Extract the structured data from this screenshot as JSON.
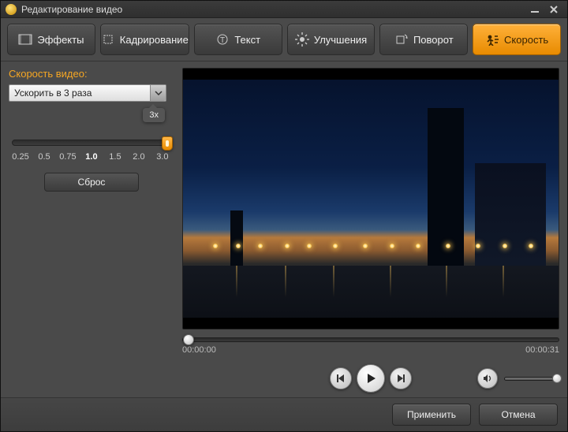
{
  "titlebar": {
    "title": "Редактирование видео"
  },
  "tabs": {
    "effects": "Эффекты",
    "crop": "Кадрирование",
    "text": "Текст",
    "enhance": "Улучшения",
    "rotate": "Поворот",
    "speed": "Скорость"
  },
  "speed": {
    "label": "Скорость видео:",
    "select_value": "Ускорить в 3 раза",
    "tooltip": "3x",
    "reset": "Сброс",
    "ticks": [
      "0.25",
      "0.5",
      "0.75",
      "1.0",
      "1.5",
      "2.0",
      "3.0"
    ]
  },
  "player": {
    "cur_time": "00:00:00",
    "total_time": "00:00:31"
  },
  "footer": {
    "apply": "Применить",
    "cancel": "Отмена"
  }
}
